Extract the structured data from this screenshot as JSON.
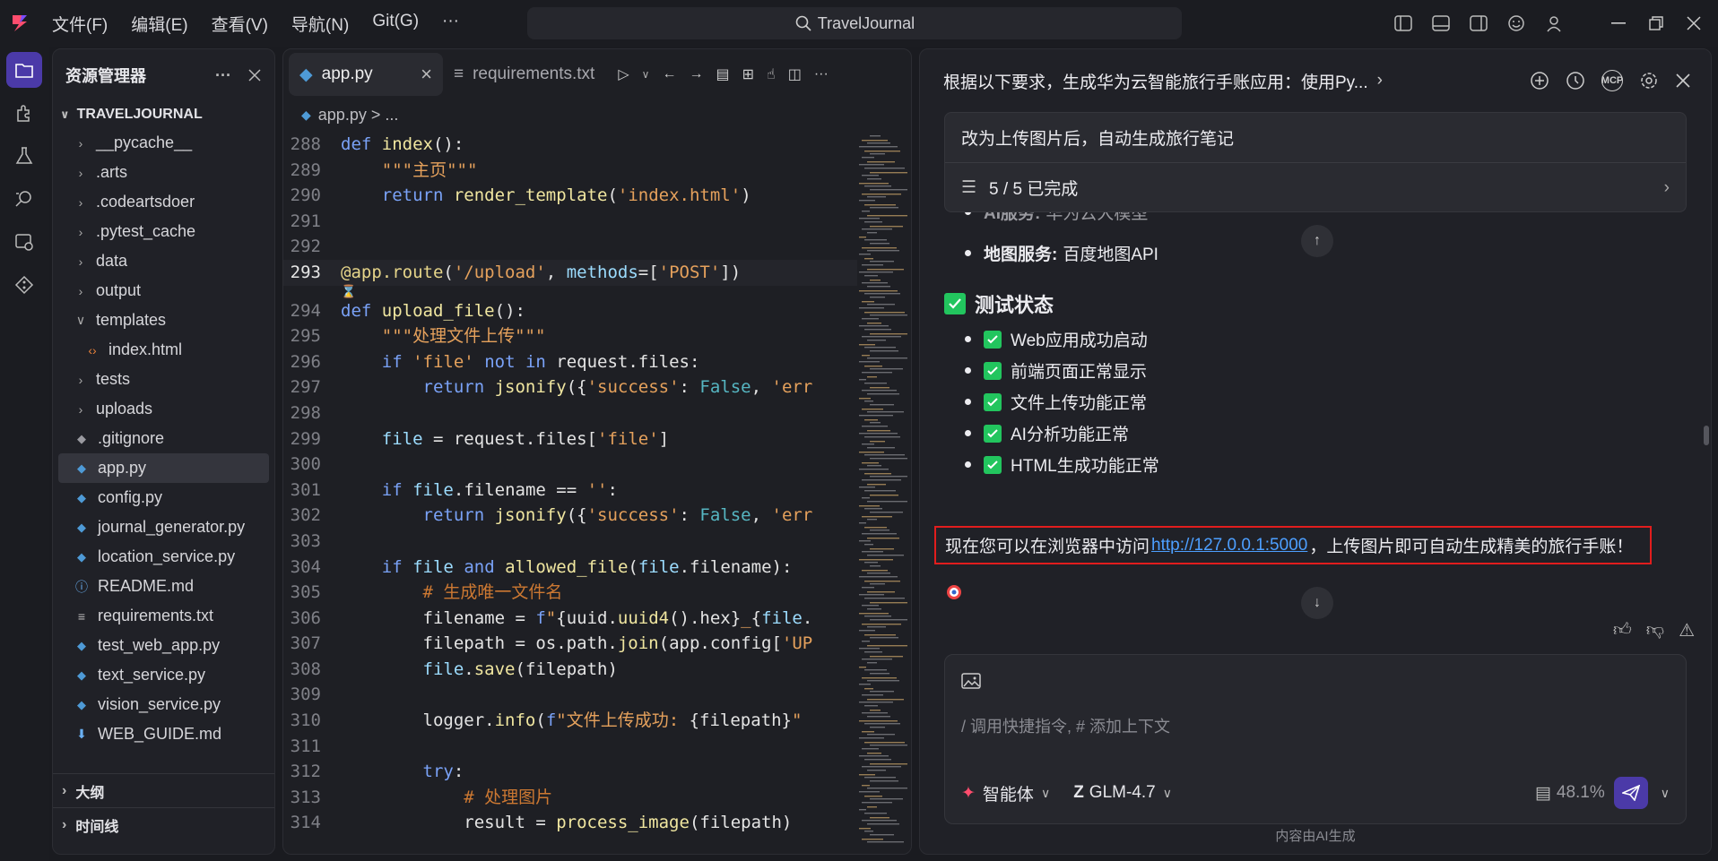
{
  "menu": [
    "文件(F)",
    "编辑(E)",
    "查看(V)",
    "导航(N)",
    "Git(G)",
    "···"
  ],
  "search": {
    "label": "TravelJournal"
  },
  "explorer": {
    "title": "资源管理器",
    "root": "TRAVELJOURNAL",
    "items": [
      {
        "label": "__pycache__",
        "type": "folder"
      },
      {
        "label": ".arts",
        "type": "folder"
      },
      {
        "label": ".codeartsdoer",
        "type": "folder"
      },
      {
        "label": ".pytest_cache",
        "type": "folder"
      },
      {
        "label": "data",
        "type": "folder"
      },
      {
        "label": "output",
        "type": "folder"
      },
      {
        "label": "templates",
        "type": "folder-open"
      },
      {
        "label": "index.html",
        "type": "html"
      },
      {
        "label": "tests",
        "type": "folder"
      },
      {
        "label": "uploads",
        "type": "folder"
      },
      {
        "label": ".gitignore",
        "type": "git"
      },
      {
        "label": "app.py",
        "type": "py"
      },
      {
        "label": "config.py",
        "type": "py"
      },
      {
        "label": "journal_generator.py",
        "type": "py"
      },
      {
        "label": "location_service.py",
        "type": "py"
      },
      {
        "label": "README.md",
        "type": "info"
      },
      {
        "label": "requirements.txt",
        "type": "txt"
      },
      {
        "label": "test_web_app.py",
        "type": "py"
      },
      {
        "label": "text_service.py",
        "type": "py"
      },
      {
        "label": "vision_service.py",
        "type": "py"
      },
      {
        "label": "WEB_GUIDE.md",
        "type": "md"
      }
    ],
    "outline": "大纲",
    "timeline": "时间线"
  },
  "editor": {
    "tab_active": "app.py",
    "tab_other": "requirements.txt",
    "breadcrumb": "app.py > ...",
    "lines": [
      {
        "n": "288",
        "html": "<span class=\"kw\">def</span> <span class=\"fn\">index</span>():"
      },
      {
        "n": "289",
        "html": "    <span class=\"str\">\"\"\"主页\"\"\"</span>"
      },
      {
        "n": "290",
        "html": "    <span class=\"kw\">return</span> <span class=\"fn\">render_template</span>(<span class=\"str\">'index.html'</span>)"
      },
      {
        "n": "291",
        "html": ""
      },
      {
        "n": "292",
        "html": ""
      },
      {
        "n": "293",
        "html": "<span class=\"dec\">@app.route</span>(<span class=\"str\">'/upload'</span>, <span class=\"prm\">methods</span>=[<span class=\"str\">'POST'</span>])",
        "cur": true
      },
      {
        "n": "",
        "html": "⌛"
      },
      {
        "n": "294",
        "html": "<span class=\"kw\">def</span> <span class=\"fn\">upload_file</span>():"
      },
      {
        "n": "295",
        "html": "    <span class=\"str\">\"\"\"处理文件上传\"\"\"</span>"
      },
      {
        "n": "296",
        "html": "    <span class=\"kw\">if</span> <span class=\"str\">'file'</span> <span class=\"kw\">not in</span> request.files:"
      },
      {
        "n": "297",
        "html": "        <span class=\"kw\">return</span> <span class=\"fn\">jsonify</span>({<span class=\"str\">'success'</span>: <span class=\"bool\">False</span>, <span class=\"str\">'err</span>"
      },
      {
        "n": "298",
        "html": ""
      },
      {
        "n": "299",
        "html": "    <span class=\"prm\">file</span> = request.files[<span class=\"str\">'file'</span>]"
      },
      {
        "n": "300",
        "html": ""
      },
      {
        "n": "301",
        "html": "    <span class=\"kw\">if</span> <span class=\"prm\">file</span>.filename == <span class=\"str\">''</span>:"
      },
      {
        "n": "302",
        "html": "        <span class=\"kw\">return</span> <span class=\"fn\">jsonify</span>({<span class=\"str\">'success'</span>: <span class=\"bool\">False</span>, <span class=\"str\">'err</span>"
      },
      {
        "n": "303",
        "html": ""
      },
      {
        "n": "304",
        "html": "    <span class=\"kw\">if</span> <span class=\"prm\">file</span> <span class=\"kw\">and</span> <span class=\"fn\">allowed_file</span>(<span class=\"prm\">file</span>.filename):"
      },
      {
        "n": "305",
        "html": "        <span class=\"cm\"># 生成唯一文件名</span>"
      },
      {
        "n": "306",
        "html": "        filename = <span class=\"kw\">f</span><span class=\"str\">\"</span>{uuid.<span class=\"fn\">uuid4</span>().hex}<span class=\"str\">_</span>{<span class=\"prm\">file</span>."
      },
      {
        "n": "307",
        "html": "        filepath = os.path.<span class=\"fn\">join</span>(app.config[<span class=\"str\">'UP</span>"
      },
      {
        "n": "308",
        "html": "        <span class=\"prm\">file</span>.<span class=\"fn\">save</span>(filepath)"
      },
      {
        "n": "309",
        "html": ""
      },
      {
        "n": "310",
        "html": "        logger.<span class=\"fn\">info</span>(<span class=\"kw\">f</span><span class=\"str\">\"文件上传成功: </span>{filepath}<span class=\"str\">\"</span>"
      },
      {
        "n": "311",
        "html": ""
      },
      {
        "n": "312",
        "html": "        <span class=\"kw\">try</span>:"
      },
      {
        "n": "313",
        "html": "            <span class=\"cm\"># 处理图片</span>"
      },
      {
        "n": "314",
        "html": "            result = <span class=\"fn\">process_image</span>(filepath)"
      }
    ]
  },
  "chat": {
    "title": "根据以下要求，生成华为云智能旅行手账应用：使用Py...",
    "request": "改为上传图片后，自动生成旅行笔记",
    "progress": "5 / 5 已完成",
    "partial_bullet": {
      "label": "AI服务:",
      "value": "华为云大模型"
    },
    "map_bullet": {
      "label": "地图服务:",
      "value": "百度地图API"
    },
    "section_title": "测试状态",
    "checks": [
      "Web应用成功启动",
      "前端页面正常显示",
      "文件上传功能正常",
      "AI分析功能正常",
      "HTML生成功能正常"
    ],
    "final_prefix": "现在您可以在浏览器中访问",
    "final_link": "http://127.0.0.1:5000",
    "final_suffix": "，上传图片即可自动生成精美的旅行手账！",
    "input_placeholder": "/ 调用快捷指令, # 添加上下文",
    "agent_label": "智能体",
    "model_label": "GLM-4.7",
    "context_pct": "48.1%",
    "footer": "内容由AI生成"
  },
  "colors": {
    "accent": "#4b3aa8",
    "check": "#22c55e",
    "highlight_border": "#e11d1d",
    "link": "#4d9fff"
  }
}
